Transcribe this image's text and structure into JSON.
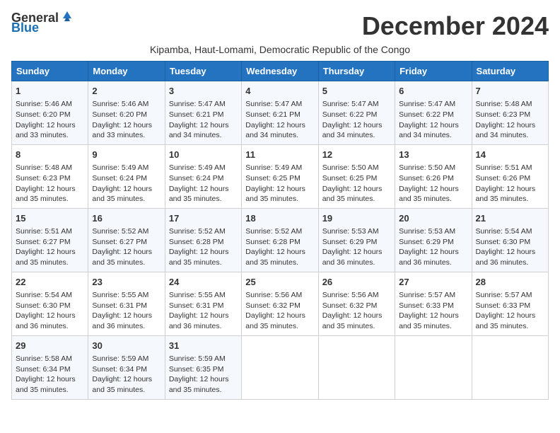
{
  "logo": {
    "general": "General",
    "blue": "Blue"
  },
  "title": "December 2024",
  "subtitle": "Kipamba, Haut-Lomami, Democratic Republic of the Congo",
  "weekdays": [
    "Sunday",
    "Monday",
    "Tuesday",
    "Wednesday",
    "Thursday",
    "Friday",
    "Saturday"
  ],
  "weeks": [
    [
      {
        "day": "1",
        "info": "Sunrise: 5:46 AM\nSunset: 6:20 PM\nDaylight: 12 hours\nand 33 minutes."
      },
      {
        "day": "2",
        "info": "Sunrise: 5:46 AM\nSunset: 6:20 PM\nDaylight: 12 hours\nand 33 minutes."
      },
      {
        "day": "3",
        "info": "Sunrise: 5:47 AM\nSunset: 6:21 PM\nDaylight: 12 hours\nand 34 minutes."
      },
      {
        "day": "4",
        "info": "Sunrise: 5:47 AM\nSunset: 6:21 PM\nDaylight: 12 hours\nand 34 minutes."
      },
      {
        "day": "5",
        "info": "Sunrise: 5:47 AM\nSunset: 6:22 PM\nDaylight: 12 hours\nand 34 minutes."
      },
      {
        "day": "6",
        "info": "Sunrise: 5:47 AM\nSunset: 6:22 PM\nDaylight: 12 hours\nand 34 minutes."
      },
      {
        "day": "7",
        "info": "Sunrise: 5:48 AM\nSunset: 6:23 PM\nDaylight: 12 hours\nand 34 minutes."
      }
    ],
    [
      {
        "day": "8",
        "info": "Sunrise: 5:48 AM\nSunset: 6:23 PM\nDaylight: 12 hours\nand 35 minutes."
      },
      {
        "day": "9",
        "info": "Sunrise: 5:49 AM\nSunset: 6:24 PM\nDaylight: 12 hours\nand 35 minutes."
      },
      {
        "day": "10",
        "info": "Sunrise: 5:49 AM\nSunset: 6:24 PM\nDaylight: 12 hours\nand 35 minutes."
      },
      {
        "day": "11",
        "info": "Sunrise: 5:49 AM\nSunset: 6:25 PM\nDaylight: 12 hours\nand 35 minutes."
      },
      {
        "day": "12",
        "info": "Sunrise: 5:50 AM\nSunset: 6:25 PM\nDaylight: 12 hours\nand 35 minutes."
      },
      {
        "day": "13",
        "info": "Sunrise: 5:50 AM\nSunset: 6:26 PM\nDaylight: 12 hours\nand 35 minutes."
      },
      {
        "day": "14",
        "info": "Sunrise: 5:51 AM\nSunset: 6:26 PM\nDaylight: 12 hours\nand 35 minutes."
      }
    ],
    [
      {
        "day": "15",
        "info": "Sunrise: 5:51 AM\nSunset: 6:27 PM\nDaylight: 12 hours\nand 35 minutes."
      },
      {
        "day": "16",
        "info": "Sunrise: 5:52 AM\nSunset: 6:27 PM\nDaylight: 12 hours\nand 35 minutes."
      },
      {
        "day": "17",
        "info": "Sunrise: 5:52 AM\nSunset: 6:28 PM\nDaylight: 12 hours\nand 35 minutes."
      },
      {
        "day": "18",
        "info": "Sunrise: 5:52 AM\nSunset: 6:28 PM\nDaylight: 12 hours\nand 35 minutes."
      },
      {
        "day": "19",
        "info": "Sunrise: 5:53 AM\nSunset: 6:29 PM\nDaylight: 12 hours\nand 36 minutes."
      },
      {
        "day": "20",
        "info": "Sunrise: 5:53 AM\nSunset: 6:29 PM\nDaylight: 12 hours\nand 36 minutes."
      },
      {
        "day": "21",
        "info": "Sunrise: 5:54 AM\nSunset: 6:30 PM\nDaylight: 12 hours\nand 36 minutes."
      }
    ],
    [
      {
        "day": "22",
        "info": "Sunrise: 5:54 AM\nSunset: 6:30 PM\nDaylight: 12 hours\nand 36 minutes."
      },
      {
        "day": "23",
        "info": "Sunrise: 5:55 AM\nSunset: 6:31 PM\nDaylight: 12 hours\nand 36 minutes."
      },
      {
        "day": "24",
        "info": "Sunrise: 5:55 AM\nSunset: 6:31 PM\nDaylight: 12 hours\nand 36 minutes."
      },
      {
        "day": "25",
        "info": "Sunrise: 5:56 AM\nSunset: 6:32 PM\nDaylight: 12 hours\nand 35 minutes."
      },
      {
        "day": "26",
        "info": "Sunrise: 5:56 AM\nSunset: 6:32 PM\nDaylight: 12 hours\nand 35 minutes."
      },
      {
        "day": "27",
        "info": "Sunrise: 5:57 AM\nSunset: 6:33 PM\nDaylight: 12 hours\nand 35 minutes."
      },
      {
        "day": "28",
        "info": "Sunrise: 5:57 AM\nSunset: 6:33 PM\nDaylight: 12 hours\nand 35 minutes."
      }
    ],
    [
      {
        "day": "29",
        "info": "Sunrise: 5:58 AM\nSunset: 6:34 PM\nDaylight: 12 hours\nand 35 minutes."
      },
      {
        "day": "30",
        "info": "Sunrise: 5:59 AM\nSunset: 6:34 PM\nDaylight: 12 hours\nand 35 minutes."
      },
      {
        "day": "31",
        "info": "Sunrise: 5:59 AM\nSunset: 6:35 PM\nDaylight: 12 hours\nand 35 minutes."
      },
      {
        "day": "",
        "info": ""
      },
      {
        "day": "",
        "info": ""
      },
      {
        "day": "",
        "info": ""
      },
      {
        "day": "",
        "info": ""
      }
    ]
  ]
}
